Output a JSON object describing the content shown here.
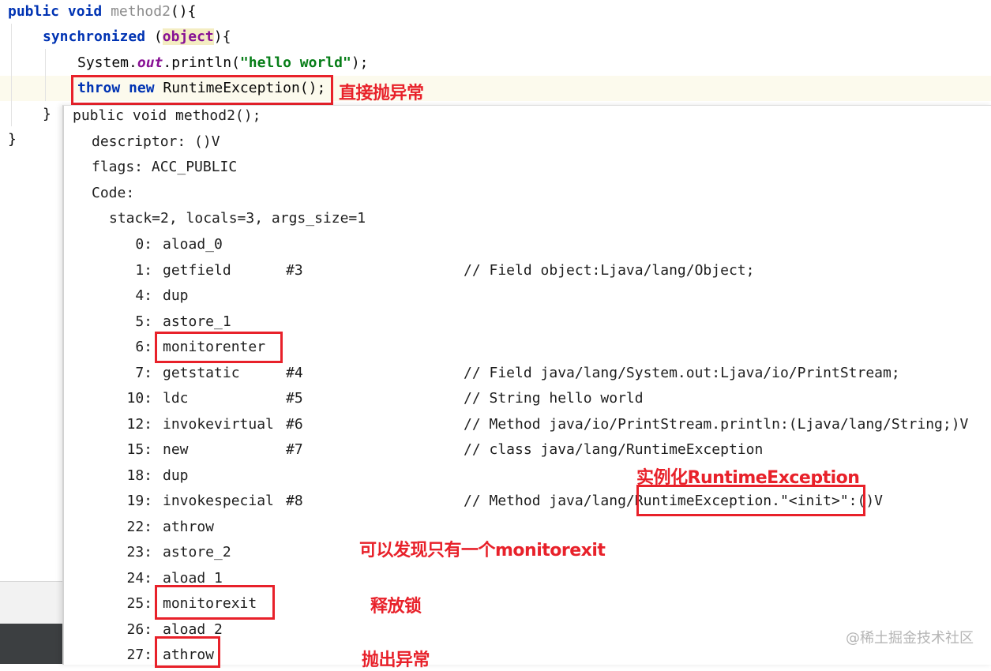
{
  "source": {
    "line1": {
      "kw": "public void",
      "name": "method2",
      "rest": "(){"
    },
    "line2": {
      "kw": "synchronized",
      "open": " (",
      "obj": "object",
      "close": "){"
    },
    "line3": {
      "cls": "System.",
      "field": "out",
      "call": ".println(",
      "str": "\"hello world\"",
      "end": ");"
    },
    "line4": {
      "kw1": "throw",
      "kw2": "new",
      "rest": " RuntimeException();"
    },
    "line5": "}",
    "line6": "}"
  },
  "bytecode": {
    "signature": "public void method2();",
    "descriptor": "descriptor: ()V",
    "flags": "flags: ACC_PUBLIC",
    "code": "Code:",
    "stack": "stack=2, locals=3, args_size=1",
    "instructions": [
      {
        "off": "0:",
        "op": "aload_0",
        "arg": "",
        "cm": ""
      },
      {
        "off": "1:",
        "op": "getfield",
        "arg": "#3",
        "cm": "// Field object:Ljava/lang/Object;"
      },
      {
        "off": "4:",
        "op": "dup",
        "arg": "",
        "cm": ""
      },
      {
        "off": "5:",
        "op": "astore_1",
        "arg": "",
        "cm": ""
      },
      {
        "off": "6:",
        "op": "monitorenter",
        "arg": "",
        "cm": ""
      },
      {
        "off": "7:",
        "op": "getstatic",
        "arg": "#4",
        "cm": "// Field java/lang/System.out:Ljava/io/PrintStream;"
      },
      {
        "off": "10:",
        "op": "ldc",
        "arg": "#5",
        "cm": "// String hello world"
      },
      {
        "off": "12:",
        "op": "invokevirtual",
        "arg": "#6",
        "cm": "// Method java/io/PrintStream.println:(Ljava/lang/String;)V"
      },
      {
        "off": "15:",
        "op": "new",
        "arg": "#7",
        "cm": "// class java/lang/RuntimeException"
      },
      {
        "off": "18:",
        "op": "dup",
        "arg": "",
        "cm": ""
      },
      {
        "off": "19:",
        "op": "invokespecial",
        "arg": "#8",
        "cm": "// Method java/lang/RuntimeException.\"<init>\":()V"
      },
      {
        "off": "22:",
        "op": "athrow",
        "arg": "",
        "cm": ""
      },
      {
        "off": "23:",
        "op": "astore_2",
        "arg": "",
        "cm": ""
      },
      {
        "off": "24:",
        "op": "aload_1",
        "arg": "",
        "cm": ""
      },
      {
        "off": "25:",
        "op": "monitorexit",
        "arg": "",
        "cm": ""
      },
      {
        "off": "26:",
        "op": "aload_2",
        "arg": "",
        "cm": ""
      },
      {
        "off": "27:",
        "op": "athrow",
        "arg": "",
        "cm": ""
      }
    ]
  },
  "annotations": {
    "throw_direct": "直接抛异常",
    "instantiate": "实例化RuntimeException",
    "only_one_exit": "可以发现只有一个monitorexit",
    "release_lock": "释放锁",
    "throw_exception": "抛出异常"
  },
  "watermark": "@稀土掘金技术社区",
  "colors": {
    "annotation": "#e8212a",
    "keyword": "#0033b3",
    "string": "#067d17",
    "field": "#871094"
  }
}
